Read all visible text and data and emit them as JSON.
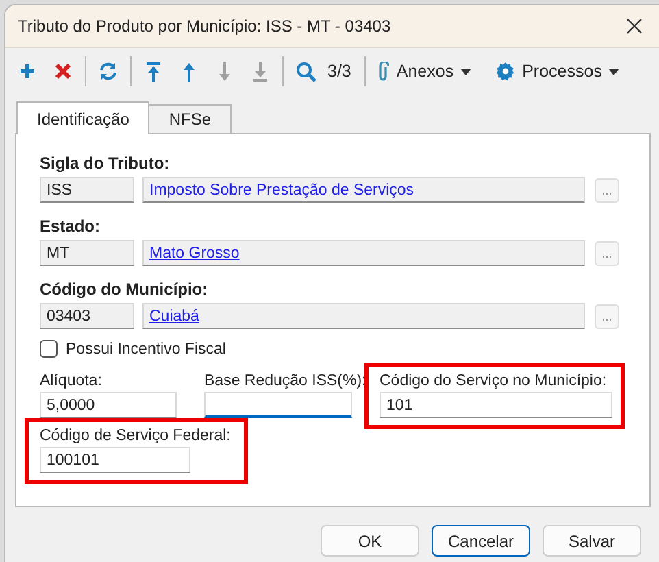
{
  "window": {
    "title": "Tributo do Produto por Município: ISS - MT - 03403"
  },
  "toolbar": {
    "buttons": [
      {
        "kind": "add",
        "disabled": false
      },
      {
        "kind": "delete",
        "disabled": false
      },
      {
        "kind": "refresh",
        "disabled": false
      },
      {
        "kind": "first",
        "disabled": false
      },
      {
        "kind": "previous",
        "disabled": false
      },
      {
        "kind": "next",
        "disabled": true
      },
      {
        "kind": "last",
        "disabled": true
      },
      {
        "kind": "search",
        "disabled": false
      }
    ],
    "record_counter": "3/3",
    "menus": [
      {
        "kind": "attachments",
        "label": "Anexos"
      },
      {
        "kind": "processes",
        "label": "Processos"
      }
    ]
  },
  "tabs": [
    {
      "label": "Identificação",
      "selected": true
    },
    {
      "label": "NFSe",
      "selected": false
    }
  ],
  "lookups": [
    {
      "label": "Sigla do Tributo:",
      "code": "ISS",
      "description": "Imposto Sobre Prestação de Serviços",
      "link": false,
      "button": "..."
    },
    {
      "label": "Estado:",
      "code": "MT",
      "description": "Mato Grosso",
      "link": true,
      "button": "..."
    },
    {
      "label": "Código do Município:",
      "code": "03403",
      "description": "Cuiabá",
      "link": true,
      "button": "..."
    }
  ],
  "checkbox": {
    "label": "Possui Incentivo Fiscal",
    "checked": false
  },
  "fields": [
    {
      "label": "Alíquota:",
      "value": "5,0000",
      "focused": false,
      "highlighted": false
    },
    {
      "label": "Base Redução ISS(%):",
      "focused": true,
      "highlighted": false
    },
    {
      "label": "Código do Serviço no Município:",
      "value": "101",
      "focused": false,
      "highlighted": true
    },
    {
      "label": "Código de Serviço Federal:",
      "value": "100101",
      "focused": false,
      "highlighted": true
    }
  ],
  "buttons": [
    {
      "label": "OK",
      "default": false
    },
    {
      "label": "Cancelar",
      "default": true
    },
    {
      "label": "Salvar",
      "default": false
    }
  ]
}
